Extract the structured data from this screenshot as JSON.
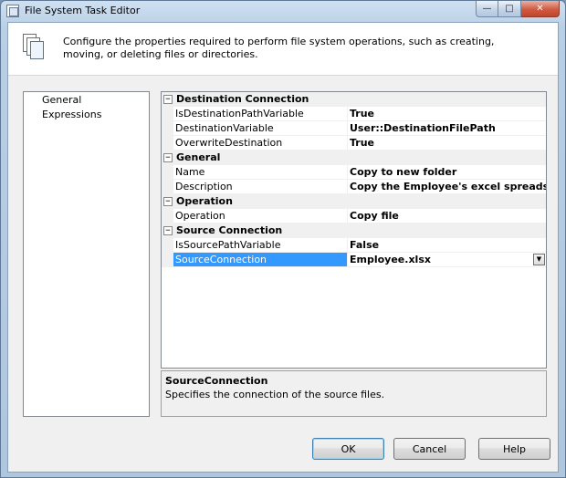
{
  "window": {
    "title": "File System Task Editor",
    "caption_buttons": {
      "minimize": "—",
      "maximize": "□",
      "close": "✕"
    }
  },
  "header": {
    "description": "Configure the properties required to perform file system operations, such as creating, moving, or deleting files or directories."
  },
  "nav": {
    "items": [
      {
        "label": "General"
      },
      {
        "label": "Expressions"
      }
    ]
  },
  "grid": {
    "categories": [
      {
        "label": "Destination Connection",
        "expander": "−",
        "properties": [
          {
            "name": "IsDestinationPathVariable",
            "value": "True"
          },
          {
            "name": "DestinationVariable",
            "value": "User::DestinationFilePath"
          },
          {
            "name": "OverwriteDestination",
            "value": "True"
          }
        ]
      },
      {
        "label": "General",
        "expander": "−",
        "properties": [
          {
            "name": "Name",
            "value": "Copy to new folder"
          },
          {
            "name": "Description",
            "value": "Copy the Employee's excel spreadsheet to d:\\D"
          }
        ]
      },
      {
        "label": "Operation",
        "expander": "−",
        "properties": [
          {
            "name": "Operation",
            "value": "Copy file"
          }
        ]
      },
      {
        "label": "Source Connection",
        "expander": "−",
        "properties": [
          {
            "name": "IsSourcePathVariable",
            "value": "False"
          },
          {
            "name": "SourceConnection",
            "value": "Employee.xlsx",
            "dropdown_glyph": "▼"
          }
        ]
      }
    ]
  },
  "description_pane": {
    "title": "SourceConnection",
    "text": "Specifies the connection of the source files."
  },
  "buttons": {
    "ok": "OK",
    "cancel": "Cancel",
    "help": "Help"
  },
  "colors": {
    "selection": "#3399ff",
    "category_background": "#f0f0f0"
  }
}
